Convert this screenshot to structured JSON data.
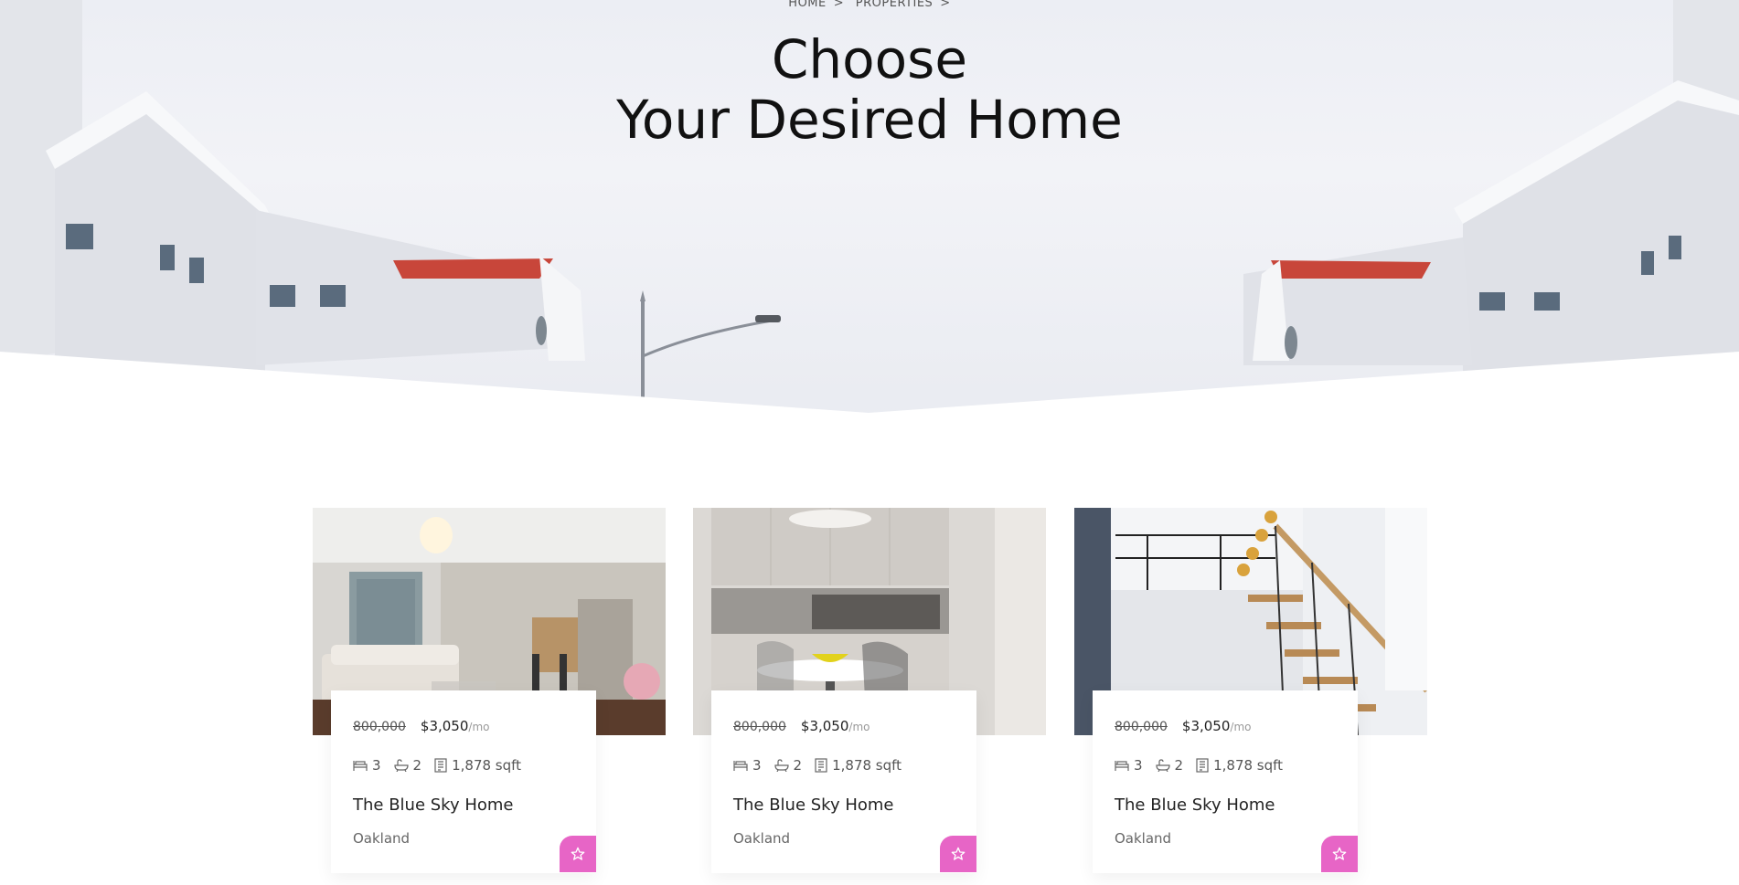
{
  "breadcrumb": {
    "home": "HOME",
    "properties": "PROPERTIES",
    "separator": ">"
  },
  "hero": {
    "title_line1": "Choose",
    "title_line2": "Your Desired Home"
  },
  "accent_color": "#e765c6",
  "cards": [
    {
      "old_price": "800,000",
      "price": "$3,050",
      "per": "/mo",
      "beds": "3",
      "baths": "2",
      "area": "1,878 sqft",
      "title": "The Blue Sky Home",
      "location": "Oakland",
      "image": "living-room"
    },
    {
      "old_price": "800,000",
      "price": "$3,050",
      "per": "/mo",
      "beds": "3",
      "baths": "2",
      "area": "1,878 sqft",
      "title": "The Blue Sky Home",
      "location": "Oakland",
      "image": "kitchen"
    },
    {
      "old_price": "800,000",
      "price": "$3,050",
      "per": "/mo",
      "beds": "3",
      "baths": "2",
      "area": "1,878 sqft",
      "title": "The Blue Sky Home",
      "location": "Oakland",
      "image": "staircase"
    }
  ],
  "icons": {
    "bed": "bed-icon",
    "bath": "bath-icon",
    "area": "area-icon",
    "favorite": "star-icon"
  }
}
